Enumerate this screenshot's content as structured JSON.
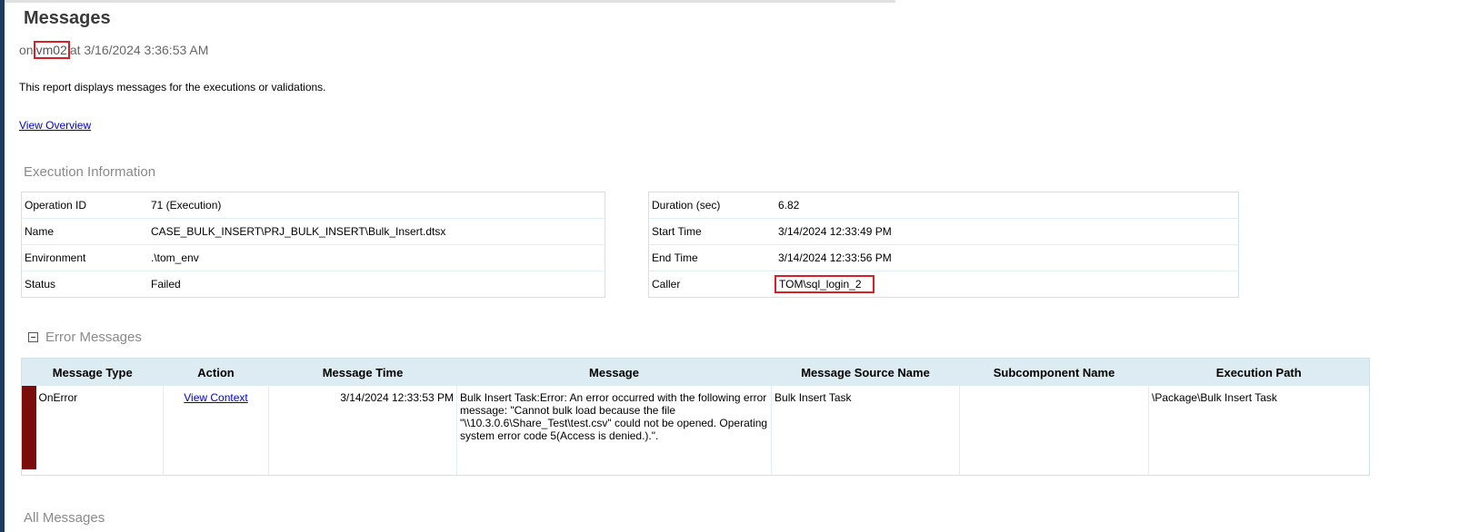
{
  "page": {
    "title": "Messages",
    "subtitle_prefix": "on",
    "server": "vm02",
    "subtitle_suffix": "at 3/16/2024 3:36:53 AM",
    "description": "This report displays messages for the executions or validations.",
    "view_overview": "View Overview"
  },
  "execution_info": {
    "title": "Execution Information",
    "left": [
      {
        "label": "Operation ID",
        "value": "71 (Execution)"
      },
      {
        "label": "Name",
        "value": "CASE_BULK_INSERT\\PRJ_BULK_INSERT\\Bulk_Insert.dtsx"
      },
      {
        "label": "Environment",
        "value": ".\\tom_env"
      },
      {
        "label": "Status",
        "value": "Failed"
      }
    ],
    "right": [
      {
        "label": "Duration (sec)",
        "value": "6.82"
      },
      {
        "label": "Start Time",
        "value": "3/14/2024 12:33:49 PM"
      },
      {
        "label": "End Time",
        "value": "3/14/2024 12:33:56 PM"
      },
      {
        "label": "Caller",
        "value": "TOM\\sql_login_2"
      }
    ]
  },
  "error_messages": {
    "title": "Error Messages",
    "columns": [
      "Message Type",
      "Action",
      "Message Time",
      "Message",
      "Message Source Name",
      "Subcomponent Name",
      "Execution Path"
    ],
    "rows": [
      {
        "message_type": "OnError",
        "action": "View Context",
        "message_time": "3/14/2024 12:33:53 PM",
        "message": "Bulk Insert Task:Error: An error occurred with the following error message: \"Cannot bulk load because the file \"\\\\10.3.0.6\\Share_Test\\test.csv\" could not be opened. Operating system error code 5(Access is denied.).\".",
        "source_name": "Bulk Insert Task",
        "subcomponent": "",
        "execution_path": "\\Package\\Bulk Insert Task",
        "severity_color": "#7a0c0c"
      }
    ]
  },
  "all_messages": {
    "title": "All Messages"
  },
  "colors": {
    "highlight": "#d91e26",
    "header_bg": "#dcecf2",
    "link": "#0000cc"
  }
}
